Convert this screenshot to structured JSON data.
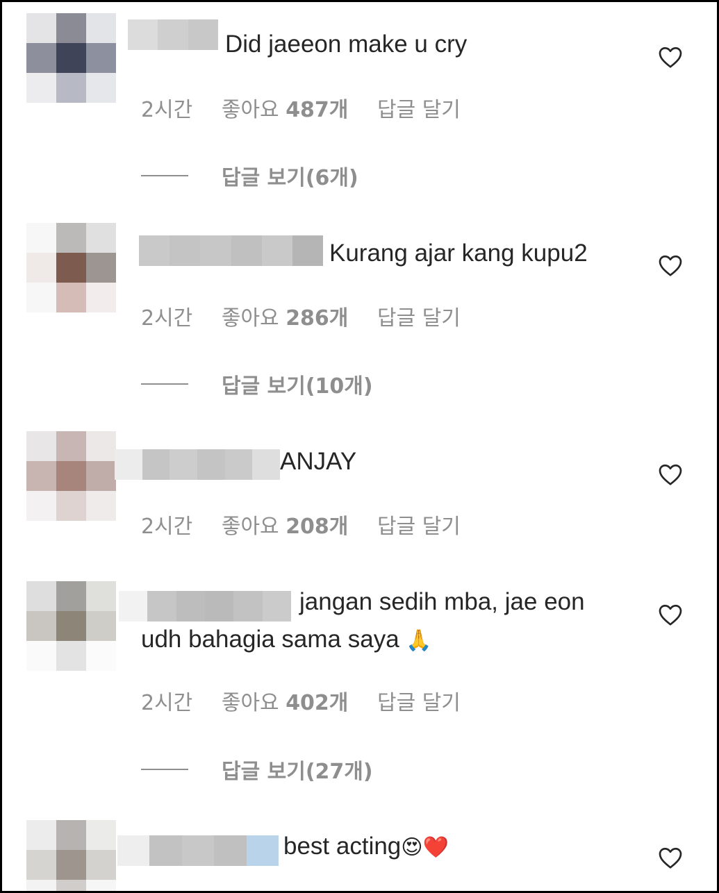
{
  "comments": [
    {
      "text": "Did jaeeon make u cry",
      "time": "2시간",
      "likes_prefix": "좋아요 ",
      "likes_count": "487개",
      "reply_action": "답글 달기",
      "view_replies": "답글 보기(6개)"
    },
    {
      "text": "Kurang ajar kang kupu2",
      "time": "2시간",
      "likes_prefix": "좋아요 ",
      "likes_count": "286개",
      "reply_action": "답글 달기",
      "view_replies": "답글 보기(10개)"
    },
    {
      "text": "ANJAY",
      "time": "2시간",
      "likes_prefix": "좋아요 ",
      "likes_count": "208개",
      "reply_action": "답글 달기"
    },
    {
      "text_line1": "jangan sedih mba, jae eon",
      "text_line2": "udh bahagia sama saya",
      "emoji": "🙏",
      "time": "2시간",
      "likes_prefix": "좋아요 ",
      "likes_count": "402개",
      "reply_action": "답글 달기",
      "view_replies": "답글 보기(27개)"
    },
    {
      "text": "best acting",
      "emoji": "😍❤️"
    }
  ],
  "colors": {
    "text": "#262626",
    "meta": "#8e8e8e",
    "border": "#000000"
  },
  "icons": {
    "like": "heart-outline-icon"
  }
}
